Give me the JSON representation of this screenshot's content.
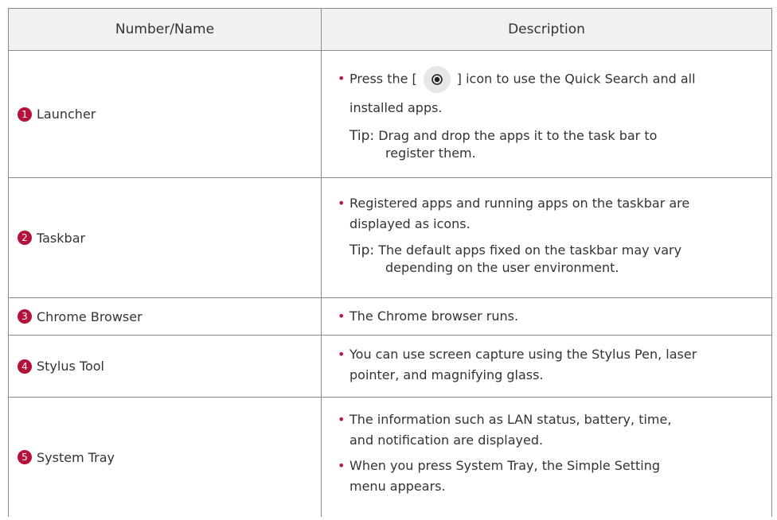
{
  "table": {
    "headers": {
      "name": "Number/Name",
      "description": "Description"
    },
    "rows": [
      {
        "number": "1",
        "name": "Launcher",
        "bullets": [
          {
            "pre": "Press the [",
            "post": "] icon to use the Quick Search and all",
            "cont": "installed apps."
          }
        ],
        "tip_label": "Tip:",
        "tip_text": "Drag and drop the apps it to the task bar to",
        "tip_text_cont": "register them."
      },
      {
        "number": "2",
        "name": "Taskbar",
        "bullets": [
          {
            "text": "Registered apps and running apps on the taskbar are",
            "cont": "displayed as icons."
          }
        ],
        "tip_label": "Tip:",
        "tip_text": "The default apps fixed on the taskbar may vary",
        "tip_text_cont": "depending on the user environment."
      },
      {
        "number": "3",
        "name": "Chrome Browser",
        "bullets": [
          {
            "text": "The Chrome browser runs."
          }
        ]
      },
      {
        "number": "4",
        "name": "Stylus Tool",
        "bullets": [
          {
            "text": "You can use screen capture using the Stylus Pen, laser",
            "cont": "pointer, and magnifying glass."
          }
        ]
      },
      {
        "number": "5",
        "name": "System Tray",
        "bullets": [
          {
            "text": "The information such as LAN status, battery, time,",
            "cont": "and notification are displayed."
          },
          {
            "text": "When you press System Tray, the Simple Setting",
            "cont": "menu appears."
          }
        ]
      }
    ]
  },
  "icons": {
    "bullet": "bullet-dot",
    "launcher": "target-icon"
  },
  "colors": {
    "accent": "#b5123a",
    "bullet": "#c0124a",
    "header_bg": "#f1f1f1",
    "border": "#8a8a8a"
  }
}
